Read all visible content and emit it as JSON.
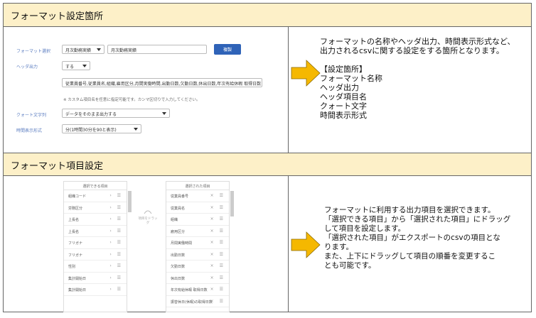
{
  "section1": {
    "title": "フォーマット設定箇所",
    "form": {
      "format_label": "フォーマット選択",
      "format_select": "月次勤務実績",
      "format_name": "月次勤務実績",
      "save_button": "複製",
      "header_label": "ヘッダ出力",
      "header_select": "する",
      "header_items": "従業員番号,従業員名,組織,雇用区分,月間実働時間,出勤日数,欠勤日数,休出日数,年次有給休暇 取得日数",
      "header_note": "※ カスタム項目名を任意に指定可能です。カンマ区切りで入力してください。",
      "quote_label": "クォート文字列",
      "quote_select": "データをそのまま出力する",
      "time_label": "時間表示形式",
      "time_select": "分(1時間30分を90と表示)"
    },
    "description": [
      "フォーマットの名称やヘッダ出力、時間表示形式など、",
      "出力されるcsvに関する設定をする箇所となります。",
      "",
      "【設定箇所】",
      "フォーマット名称",
      "ヘッダ出力",
      "ヘッダ項目名",
      "クォート文字",
      "時間表示形式"
    ]
  },
  "section2": {
    "title": "フォーマット項目設定",
    "available": {
      "title": "選択できる項目",
      "items": [
        "組織コード",
        "労務区分",
        "上長名",
        "上長名",
        "フリガナ",
        "フリガナ",
        "性別",
        "集計開始日",
        "集計開始日"
      ]
    },
    "drag_hint": "項目をドラッグ",
    "selected": {
      "title": "選択された項目",
      "items": [
        "従業員番号",
        "従業員名",
        "組織",
        "雇用区分",
        "月間実働時間",
        "出勤日数",
        "欠勤日数",
        "休出日数",
        "年次有給休暇 取得日数",
        "振替休日(休暇)の取得日数"
      ]
    },
    "description": [
      "フォーマットに利用する出力項目を選択できます。",
      "「選択できる項目」から「選択された項目」にドラッグ",
      "して項目を設定します。",
      "「選択された項目」がエクスポートのcsvの項目とな",
      "ります。",
      "また、上下にドラッグして項目の順番を変更するこ",
      "とも可能です。"
    ]
  },
  "colors": {
    "header_bg": "#fdf0c8",
    "arrow": "#f5b800",
    "button": "#2f63b8",
    "label": "#5a7cc0"
  },
  "icons": {
    "arrow": "right-arrow-icon",
    "remove": "close-icon",
    "handle": "drag-handle-icon"
  }
}
